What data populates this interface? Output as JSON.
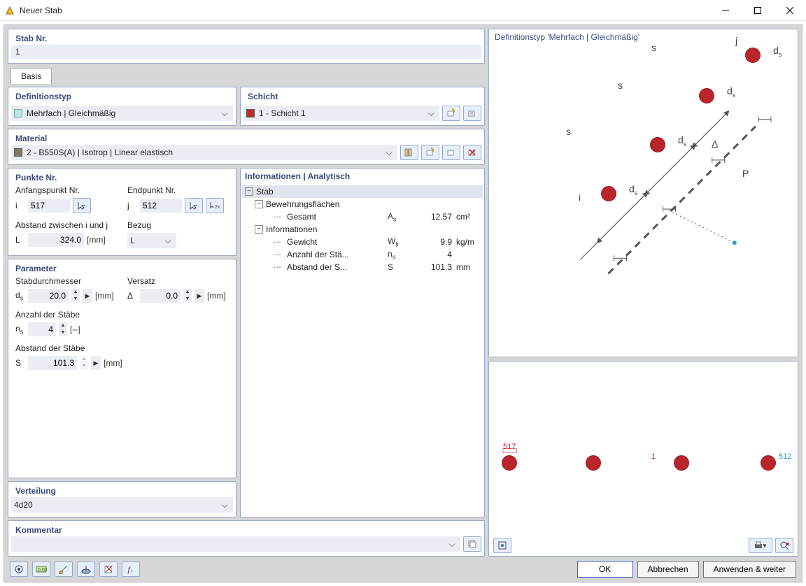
{
  "window": {
    "title": "Neuer Stab"
  },
  "stab_nr": {
    "header": "Stab Nr.",
    "value": "1"
  },
  "tabs": {
    "basis": "Basis"
  },
  "definition": {
    "header": "Definitionstyp",
    "value": "Mehrfach | Gleichmäßig"
  },
  "schicht": {
    "header": "Schicht",
    "value": "1 - Schicht 1",
    "color": "#d02424"
  },
  "material": {
    "header": "Material",
    "value": "2 - B550S(A) | Isotrop | Linear elastisch",
    "color": "#7f7a5a"
  },
  "punkte": {
    "header": "Punkte Nr.",
    "anfang_lbl": "Anfangspunkt Nr.",
    "anfang_sym": "i",
    "anfang_val": "517",
    "ende_lbl": "Endpunkt Nr.",
    "ende_sym": "j",
    "ende_val": "512",
    "abst_lbl": "Abstand zwischen i und j",
    "abst_sym": "L",
    "abst_val": "324.0",
    "abst_unit": "[mm]",
    "bezug_lbl": "Bezug",
    "bezug_val": "L"
  },
  "parameter": {
    "header": "Parameter",
    "durchm_lbl": "Stabdurchmesser",
    "durchm_sym": "ds",
    "durchm_val": "20.0",
    "durchm_unit": "[mm]",
    "versatz_lbl": "Versatz",
    "versatz_sym": "Δ",
    "versatz_val": "0.0",
    "versatz_unit": "[mm]",
    "anzahl_lbl": "Anzahl der Stäbe",
    "anzahl_sym": "ns",
    "anzahl_val": "4",
    "anzahl_unit": "[--]",
    "abstand_lbl": "Abstand der Stäbe",
    "abstand_sym": "S",
    "abstand_val": "101.3",
    "abstand_unit": "[mm]"
  },
  "verteilung": {
    "header": "Verteilung",
    "value": "4d20"
  },
  "kommentar": {
    "header": "Kommentar",
    "value": ""
  },
  "info": {
    "header": "Informationen | Analytisch",
    "root": "Stab",
    "group1": "Bewehrungsflächen",
    "gesamt_lbl": "Gesamt",
    "gesamt_sym": "As",
    "gesamt_val": "12.57",
    "gesamt_unit": "cm²",
    "group2": "Informationen",
    "gewicht_lbl": "Gewicht",
    "gewicht_sym": "Wlr",
    "gewicht_val": "9.9",
    "gewicht_unit": "kg/m",
    "anzst_lbl": "Anzahl der Stä...",
    "anzst_sym": "ns",
    "anzst_val": "4",
    "anzst_unit": "",
    "abstst_lbl": "Abstand der S...",
    "abstst_sym": "S",
    "abstst_val": "101.3",
    "abstst_unit": "mm"
  },
  "preview": {
    "header": "Definitionstyp 'Mehrfach | Gleichmäßig'",
    "lbls": {
      "s": "s",
      "i": "i",
      "j": "j",
      "ds": "d",
      "dsub": "s",
      "delta": "Δ",
      "P": "P"
    },
    "bot": {
      "p517": "517",
      "p512": "512",
      "mid": "1"
    }
  },
  "buttons": {
    "ok": "OK",
    "cancel": "Abbrechen",
    "apply": "Anwenden & weiter"
  }
}
